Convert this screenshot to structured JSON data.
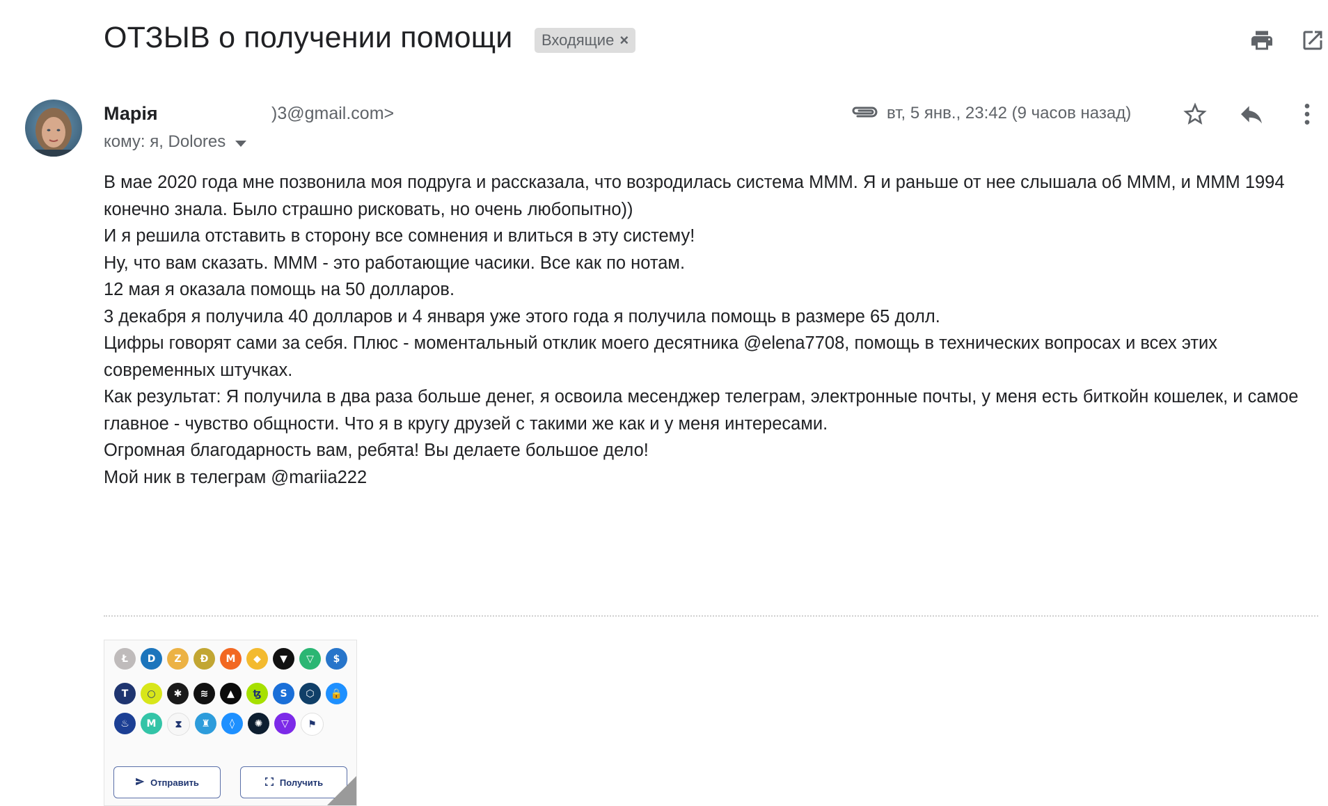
{
  "email": {
    "subject": "ОТЗЫВ о получении помощи",
    "label": "Входящие",
    "label_remove": "×",
    "sender_name": "Марія",
    "sender_email": ")3@gmail.com>",
    "recipients": "кому: я, Dolores",
    "date": "вт, 5 янв., 23:42 (9 часов назад)",
    "body": [
      "В мае 2020 года мне позвонила моя подруга и рассказала, что возродилась система МММ. Я и раньше от нее слышала об МММ, и МММ 1994 конечно знала. Было страшно рисковать, но очень любопытно))",
      "И я решила отставить в сторону все сомнения и влиться в эту систему!",
      "Ну, что вам сказать. МММ - это работающие часики. Все как по нотам.",
      "12 мая я оказала помощь на 50 долларов.",
      "3 декабря я получила 40 долларов и 4 января уже этого года я получила помощь в размере 65 долл.",
      "Цифры говорят сами за себя. Плюс - моментальный отклик моего десятника @elena7708, помощь в технических вопросах и всех этих современных штучках.",
      "Как результат: Я получила в два раза больше денег, я освоила месенджер телеграм, электронные почты, у меня есть биткойн кошелек, и самое главное - чувство общности. Что я в кругу друзей с такими же как и у меня интересами.",
      "Огромная благодарность вам, ребята! Вы делаете большое дело!",
      "Мой ник в телеграм @mariia222"
    ]
  },
  "attachment": {
    "send_label": "Отправить",
    "receive_label": "Получить",
    "coin_rows": [
      [
        {
          "icon": "litecoin-icon",
          "color": "#bfbbbb",
          "glyph": "Ł"
        },
        {
          "icon": "dash-icon",
          "color": "#1c75bc",
          "glyph": "D"
        },
        {
          "icon": "zcash-icon",
          "color": "#ecb244",
          "glyph": "Z"
        },
        {
          "icon": "dogecoin-icon",
          "color": "#c2a633",
          "glyph": "Ð"
        },
        {
          "icon": "monero-icon",
          "color": "#f26822",
          "glyph": "M"
        },
        {
          "icon": "binance-icon",
          "color": "#f3ba2f",
          "glyph": "◆"
        },
        {
          "icon": "tron-icon",
          "color": "#111111",
          "glyph": "▼"
        },
        {
          "icon": "tron-green-icon",
          "color": "#2bb673",
          "glyph": "▽"
        },
        {
          "icon": "usdc-icon",
          "color": "#2775ca",
          "glyph": "$"
        }
      ],
      [
        {
          "icon": "tether-icon",
          "color": "#1f3570",
          "glyph": "T"
        },
        {
          "icon": "yellow-coin-icon",
          "color": "#d8e61a",
          "glyph": "○"
        },
        {
          "icon": "ravencoin-icon",
          "color": "#1a1a1a",
          "glyph": "✱"
        },
        {
          "icon": "stellar-icon",
          "color": "#111111",
          "glyph": "≋"
        },
        {
          "icon": "eos-icon",
          "color": "#0b0b0b",
          "glyph": "▲"
        },
        {
          "icon": "tezos-icon",
          "color": "#a6e000",
          "glyph": "ꜩ"
        },
        {
          "icon": "swipe-icon",
          "color": "#1a6fd8",
          "glyph": "S"
        },
        {
          "icon": "crypto-com-icon",
          "color": "#103f68",
          "glyph": "⬡"
        },
        {
          "icon": "lock-coin-icon",
          "color": "#1e90ff",
          "glyph": "🔒"
        }
      ],
      [
        {
          "icon": "flame-coin-icon",
          "color": "#1c3f94",
          "glyph": "♨"
        },
        {
          "icon": "m-coin-icon",
          "color": "#33c4a7",
          "glyph": "M"
        },
        {
          "icon": "hourglass-icon",
          "color": "#f7f7f7",
          "glyph": "⧗"
        },
        {
          "icon": "castle-coin-icon",
          "color": "#2d9cdb",
          "glyph": "♜"
        },
        {
          "icon": "shield-coin-icon",
          "color": "#1e90ff",
          "glyph": "◊"
        },
        {
          "icon": "cardano-icon",
          "color": "#0d1e30",
          "glyph": "✺"
        },
        {
          "icon": "triangle-coin-icon",
          "color": "#7c2ae8",
          "glyph": "▽"
        },
        {
          "icon": "flag-coin-icon",
          "color": "#ffffff",
          "glyph": "⚑"
        }
      ]
    ]
  }
}
